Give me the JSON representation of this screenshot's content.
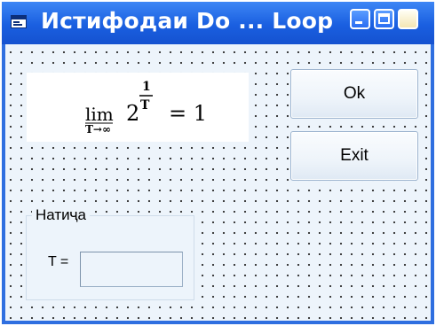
{
  "window": {
    "title": "Истифодаи Do ... Loop",
    "title_color": "#ffffff",
    "titlebar_color": "#1a5fe0",
    "client_color": "#edf4fb"
  },
  "titlebar_buttons": [
    {
      "name": "minimize",
      "icon": "minimize-icon"
    },
    {
      "name": "maximize",
      "icon": "maximize-icon"
    },
    {
      "name": "close",
      "icon": "close-icon"
    }
  ],
  "formula": {
    "lim_label": "lim",
    "subscript": "T→∞",
    "base": "2",
    "exp_numerator": "1",
    "exp_denominator": "T",
    "result": "= 1"
  },
  "buttons": {
    "ok_label": "Ok",
    "exit_label": "Exit"
  },
  "result_group": {
    "title": "Натиҷа",
    "t_label": "T =",
    "t_value": ""
  }
}
